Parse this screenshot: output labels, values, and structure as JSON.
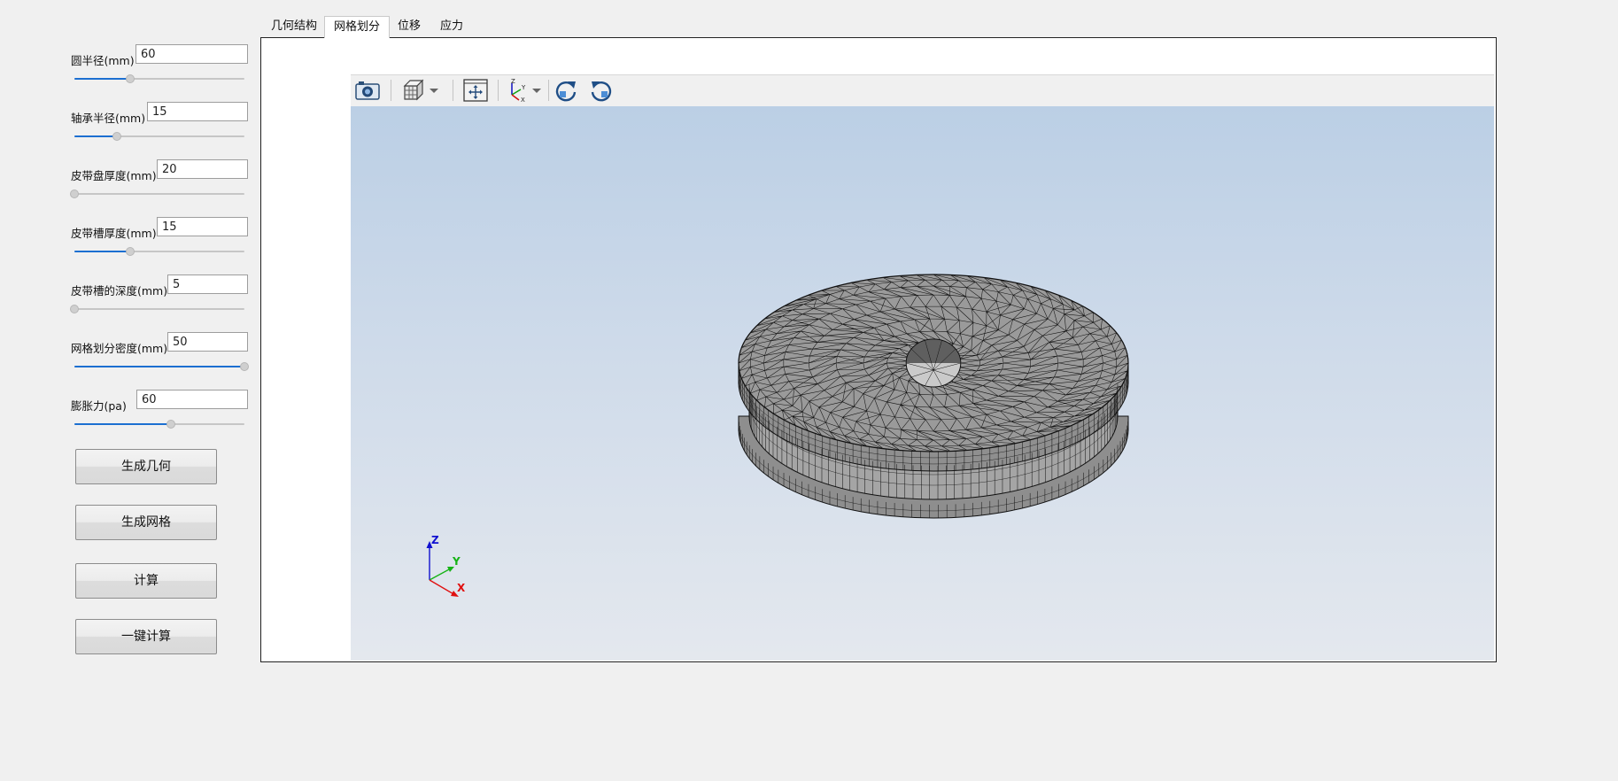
{
  "params": [
    {
      "label": "圆半径(mm)",
      "value": "60",
      "slider": 0.33
    },
    {
      "label": "轴承半径(mm)",
      "value": "15",
      "slider": 0.25
    },
    {
      "label": "皮带盘厚度(mm)",
      "value": "20",
      "slider": 0.0
    },
    {
      "label": "皮带槽厚度(mm)",
      "value": "15",
      "slider": 0.33
    },
    {
      "label": "皮带槽的深度(mm)",
      "value": "5",
      "slider": 0.0
    },
    {
      "label": "网格划分密度(mm)",
      "value": "50",
      "slider": 1.0
    },
    {
      "label": "膨胀力(pa)",
      "value": "60",
      "slider": 0.57
    }
  ],
  "buttons": {
    "gen_geometry": "生成几何",
    "gen_mesh": "生成网格",
    "compute": "计算",
    "one_click": "一键计算"
  },
  "tabs": [
    "几何结构",
    "网格划分",
    "位移",
    "应力"
  ],
  "active_tab": 1,
  "toolbar": {
    "icons": [
      "camera-icon",
      "view-cube-icon",
      "dropdown-arrow-icon",
      "fit-view-icon",
      "axes-orientation-icon",
      "dropdown-arrow-icon",
      "rotate-clockwise-icon",
      "rotate-counterclockwise-icon"
    ],
    "axes_icon_labels": {
      "z": "Z",
      "y": "Y",
      "x": "X"
    }
  },
  "axes": {
    "z": "Z",
    "y": "Y",
    "x": "X",
    "colors": {
      "z": "#1010d0",
      "y": "#16b316",
      "x": "#e01010"
    }
  },
  "colors": {
    "accent": "#1c6fd1",
    "mesh_face": "#9a9a9a",
    "mesh_edge": "#111111"
  }
}
